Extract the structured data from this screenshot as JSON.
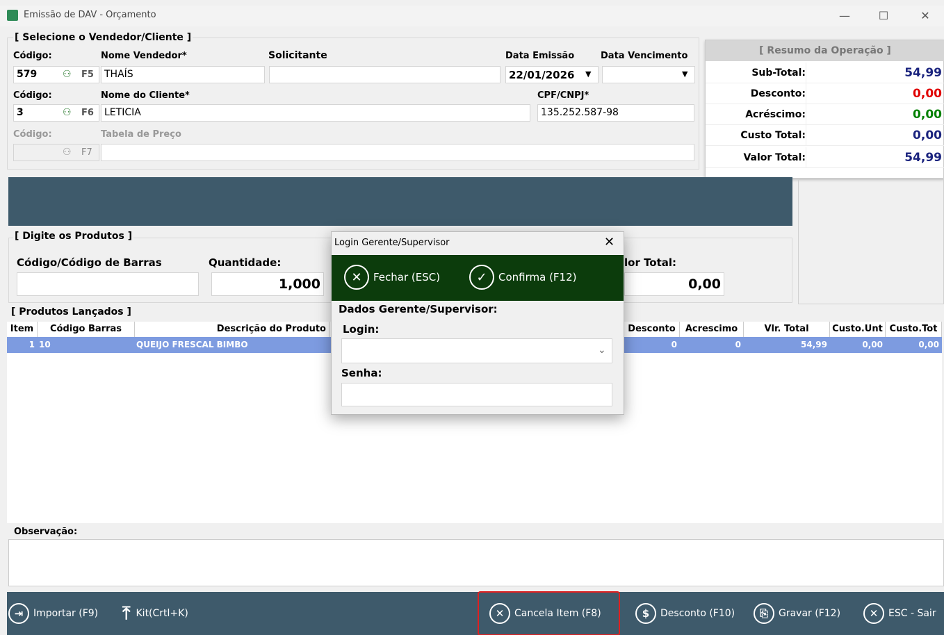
{
  "window": {
    "title": "Emissão de DAV - Orçamento",
    "minimize": "—",
    "maximize": "☐",
    "close": "✕"
  },
  "vendedor_cliente": {
    "group_title": "[ Selecione o Vendedor/Cliente ]",
    "codigo_label": "Código:",
    "nome_vendedor_label": "Nome Vendedor*",
    "solicitante_label": "Solicitante",
    "data_emissao_label": "Data Emissão",
    "data_vencimento_label": "Data Vencimento",
    "vendedor_code": "579",
    "vendedor_key": "F5",
    "vendedor_name": "THAÍS",
    "solicitante": "",
    "data_emissao": "22/01/2026",
    "data_vencimento": "",
    "codigo2_label": "Código:",
    "nome_cliente_label": "Nome do Cliente*",
    "cpf_label": "CPF/CNPJ*",
    "cliente_code": "3",
    "cliente_key": "F6",
    "cliente_name": "LETICIA",
    "cpf": "135.252.587-98",
    "codigo3_label": "Código:",
    "tabela_label": "Tabela de Preço",
    "tabela_key": "F7",
    "tabela_code": "",
    "tabela_name": ""
  },
  "resumo": {
    "title": "[ Resumo da Operação ]",
    "rows": [
      {
        "label": "Sub-Total:",
        "value": "54,99",
        "color": "#1a237e"
      },
      {
        "label": "Desconto:",
        "value": "0,00",
        "color": "#e00000"
      },
      {
        "label": "Acréscimo:",
        "value": "0,00",
        "color": "#008000"
      },
      {
        "label": "Custo Total:",
        "value": "0,00",
        "color": "#1a237e"
      },
      {
        "label": "Valor Total:",
        "value": "54,99",
        "color": "#1a237e"
      }
    ]
  },
  "produtos": {
    "group_title": "[ Digite os Produtos ]",
    "codigo_label": "Código/Código de Barras",
    "quantidade_label": "Quantidade:",
    "valor_total_label": "lor Total:",
    "codigo_value": "",
    "quantidade_value": "1,000",
    "valor_total_value": "0,00"
  },
  "lancados": {
    "group_title": "[ Produtos Lançados ]",
    "columns": [
      "Item",
      "Código Barras",
      "Descrição do Produto",
      "Desconto",
      "Acrescimo",
      "Vlr. Total",
      "Custo.Unt",
      "Custo.Tot"
    ],
    "rows": [
      {
        "item": "1",
        "codigo": "10",
        "descricao": "QUEIJO FRESCAL BIMBO",
        "desconto": "0",
        "acrescimo": "0",
        "vlr_total": "54,99",
        "custo_unt": "0,00",
        "custo_tot": "0,00"
      }
    ]
  },
  "observacao": {
    "label": "Observação:",
    "value": ""
  },
  "bottom_buttons": {
    "importar": "Importar (F9)",
    "kit": "Kit(Crtl+K)",
    "cancela": "Cancela Item (F8)",
    "desconto": "Desconto (F10)",
    "gravar": "Gravar (F12)",
    "esc": "ESC - Sair"
  },
  "modal": {
    "title": "Login Gerente/Supervisor",
    "close": "✕",
    "fechar": "Fechar (ESC)",
    "confirma": "Confirma (F12)",
    "section": "Dados Gerente/Supervisor:",
    "login_label": "Login:",
    "login_value": "",
    "senha_label": "Senha:",
    "senha_value": ""
  }
}
